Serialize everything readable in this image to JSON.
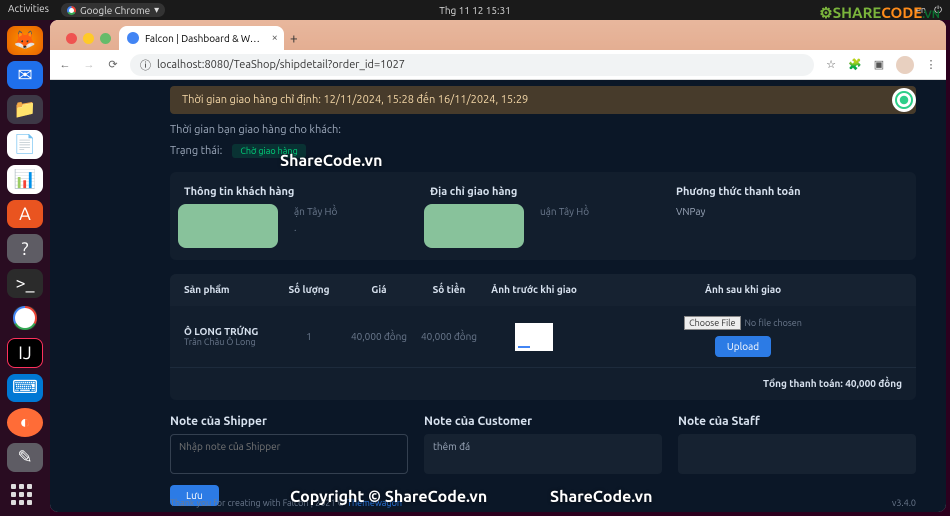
{
  "os": {
    "activities": "Activities",
    "app": "Google Chrome",
    "clock": "Thg 11 12  15:31"
  },
  "watermark": {
    "share": "SHARE",
    "code": "CODE",
    "suffix": ".VN"
  },
  "tab": {
    "title": "Falcon | Dashboard & W…"
  },
  "url": {
    "value": "localhost:8080/TeaShop/shipdetail?order_id=1027"
  },
  "page": {
    "notice": "Thời gian giao hàng chỉ định: 12/11/2024, 15:28 đến 16/11/2024, 15:29",
    "meta_line": "Thời gian bạn giao hàng cho khách:",
    "status_label": "Trạng thái:",
    "status_badge": "Chờ giao hàng",
    "col1_title": "Thông tin khách hàng",
    "col1_right": "ặn Tây Hồ",
    "col2_title": "Địa chỉ giao hàng",
    "col2_right": "uận Tây Hồ",
    "col3_title": "Phương thức thanh toán",
    "col3_value": "VNPay",
    "th": {
      "product": "Sản phẩm",
      "qty": "Số lượng",
      "price": "Giá",
      "amount": "Số tiền",
      "before": "Ảnh trước khi giao",
      "after": "Ảnh sau khi giao"
    },
    "row": {
      "name": "Ô LONG TRỨNG",
      "sub": "Trân Châu Ô Long",
      "qty": "1",
      "price": "40,000 đồng",
      "amount": "40,000 đồng",
      "choose": "Choose File",
      "nofile": "No file chosen",
      "upload": "Upload"
    },
    "total_label": "Tổng thanh toán: 40,000 đồng",
    "note_shipper_title": "Note của Shipper",
    "note_shipper_ph": "Nhập note của Shipper",
    "note_customer_title": "Note của Customer",
    "note_customer_val": "thêm đá",
    "note_staff_title": "Note của Staff",
    "save": "Lưu",
    "footer_left": "Thank you for creating with Falcon | 2021 © ",
    "footer_link": "Themewagon",
    "footer_right": "v3.4.0"
  },
  "overlay": {
    "t1": "ShareCode.vn",
    "t2": "Copyright © ShareCode.vn",
    "t3": "ShareCode.vn"
  }
}
